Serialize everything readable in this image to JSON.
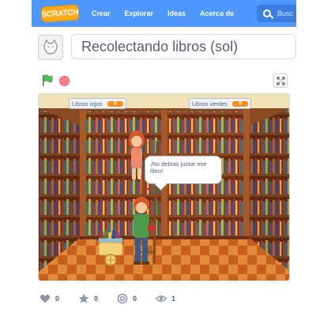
{
  "nav": {
    "logo": "SCRATCH",
    "items": [
      "Crear",
      "Explorar",
      "Ideas",
      "Acerca de"
    ],
    "search_placeholder": "Busc"
  },
  "project": {
    "title": "Recolectando libros (sol)"
  },
  "stage": {
    "monitors": [
      {
        "label": "Libros rojos",
        "value": "0"
      },
      {
        "label": "Libros verdes",
        "value": "0"
      }
    ],
    "speech": "¡No debías juntar ese libro!"
  },
  "stats": {
    "loves": "0",
    "favorites": "0",
    "remixes": "0",
    "views": "1"
  },
  "icons": {
    "flag": "green-flag-icon",
    "stop": "stop-icon",
    "fullscreen": "fullscreen-icon",
    "heart": "heart-icon",
    "star": "star-icon",
    "remix": "remix-icon",
    "eye": "eye-icon"
  },
  "colors": {
    "nav_blue": "#4d97ff",
    "logo_orange": "#ffab19",
    "monitor_orange": "#ff8c1a",
    "flag_green": "#4cbf56",
    "stop_red": "#ff7e8e"
  }
}
